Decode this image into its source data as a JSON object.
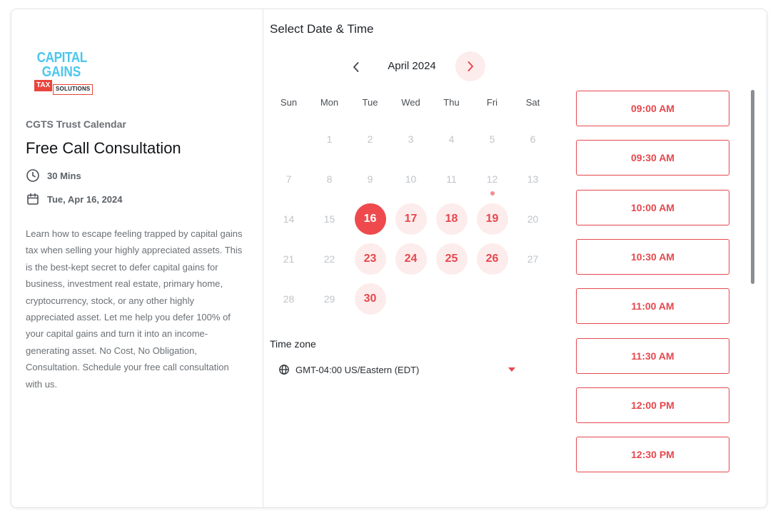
{
  "brand": {
    "logo_line1": "CAPITAL",
    "logo_line2": "GAINS",
    "logo_tag1": "TAX",
    "logo_tag2": "SOLUTIONS"
  },
  "event": {
    "organizer": "CGTS Trust Calendar",
    "title": "Free Call Consultation",
    "duration": "30 Mins",
    "date": "Tue, Apr 16, 2024",
    "description": "Learn how to escape feeling trapped by capital gains tax when selling your highly appreciated assets. This is the best-kept secret to defer capital gains for business, investment real estate, primary home, cryptocurrency, stock, or any other highly appreciated asset. Let me help you defer 100% of your capital gains and turn it into an income-generating asset. No Cost, No Obligation, Consultation. Schedule your free call consultation with us."
  },
  "scheduler": {
    "heading": "Select Date & Time",
    "month_label": "April 2024",
    "weekdays": [
      "Sun",
      "Mon",
      "Tue",
      "Wed",
      "Thu",
      "Fri",
      "Sat"
    ],
    "leading_blanks": 1,
    "days_in_month": 30,
    "available_days": [
      16,
      17,
      18,
      19,
      23,
      24,
      25,
      26,
      30
    ],
    "selected_day": 16,
    "today_marker_day": 12,
    "timezone_label": "Time zone",
    "timezone_value": "GMT-04:00 US/Eastern (EDT)",
    "time_slots": [
      "09:00 AM",
      "09:30 AM",
      "10:00 AM",
      "10:30 AM",
      "11:00 AM",
      "11:30 AM",
      "12:00 PM",
      "12:30 PM"
    ]
  },
  "colors": {
    "accent": "#e5484d",
    "accent_light": "#fdecec",
    "selected": "#ee4a4e",
    "logo_blue": "#4cc6ee"
  },
  "icons": {
    "duration": "clock-icon",
    "date": "calendar-icon",
    "prev": "chevron-left-icon",
    "next": "chevron-right-icon",
    "timezone": "globe-icon",
    "dropdown": "caret-down-icon"
  }
}
